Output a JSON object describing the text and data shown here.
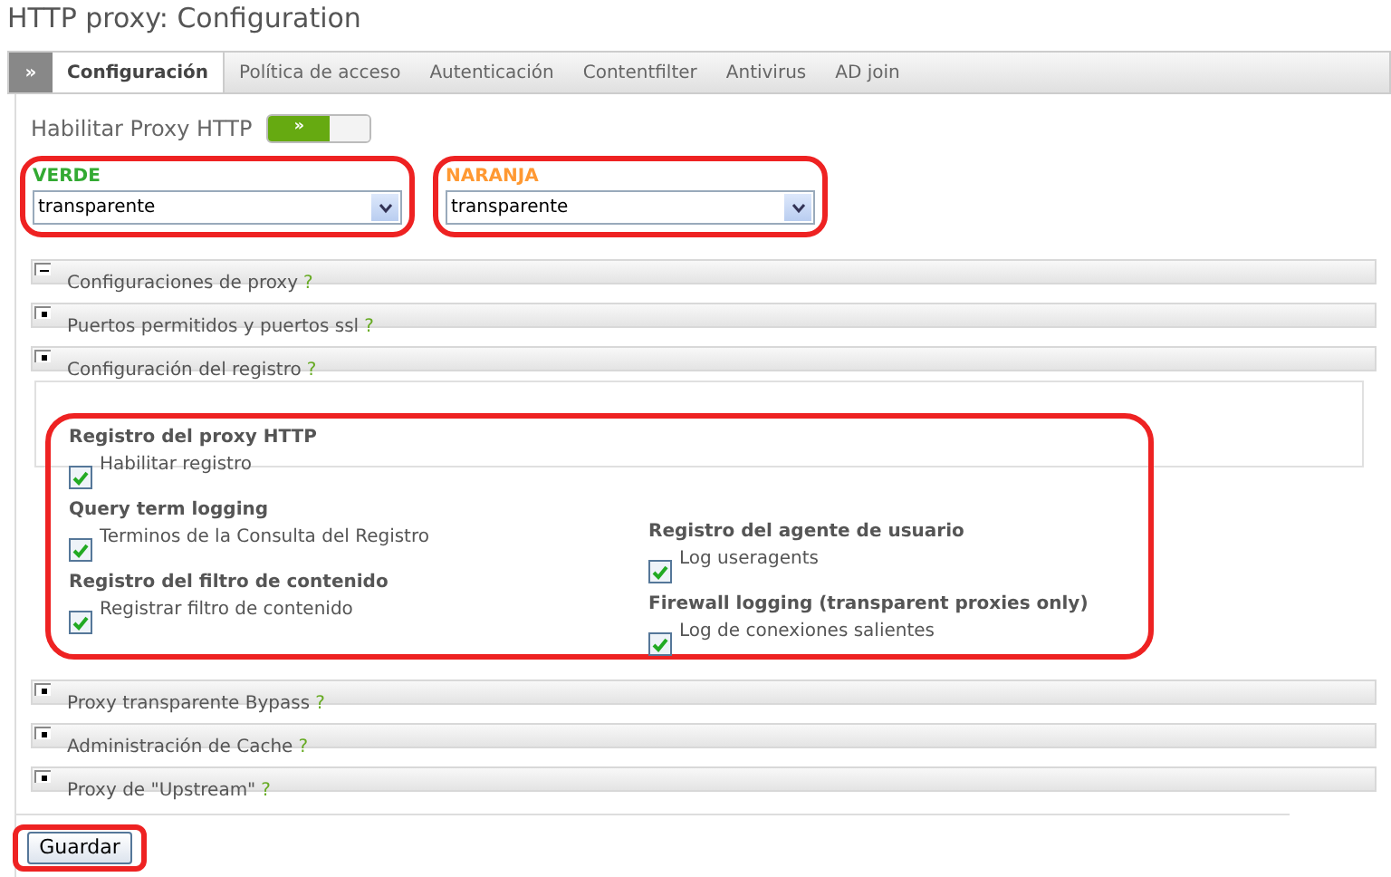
{
  "page_title": "HTTP proxy: Configuration",
  "tabs": [
    {
      "label": "»",
      "kind": "menu",
      "selected": false
    },
    {
      "label": "Configuración",
      "kind": "tab",
      "selected": true
    },
    {
      "label": "Política de acceso",
      "kind": "tab",
      "selected": false
    },
    {
      "label": "Autenticación",
      "kind": "tab",
      "selected": false
    },
    {
      "label": "Contentfilter",
      "kind": "tab",
      "selected": false
    },
    {
      "label": "Antivirus",
      "kind": "tab",
      "selected": false
    },
    {
      "label": "AD join",
      "kind": "tab",
      "selected": false
    }
  ],
  "enable": {
    "label": "Habilitar Proxy HTTP",
    "toggle_text": "»",
    "on": true
  },
  "zones": [
    {
      "label": "VERDE",
      "color": "#33aa33",
      "value": "transparente"
    },
    {
      "label": "NARANJA",
      "color": "#ff9933",
      "value": "transparente"
    }
  ],
  "sections_before": [
    {
      "title": "Configuraciones de proxy",
      "help": "?",
      "expanded": true
    },
    {
      "title": "Puertos permitidos y puertos ssl",
      "help": "?",
      "expanded": false
    },
    {
      "title": "Configuración del registro",
      "help": "?",
      "expanded": false
    }
  ],
  "logging": {
    "left": [
      {
        "heading": "Registro del proxy HTTP",
        "label": "Habilitar registro",
        "checked": true
      },
      {
        "heading": "Query term logging",
        "label": "Terminos de la Consulta del Registro",
        "checked": true
      },
      {
        "heading": "Registro del filtro de contenido",
        "label": "Registrar filtro de contenido",
        "checked": true
      }
    ],
    "right": [
      {
        "heading": "Registro del agente de usuario",
        "label": "Log useragents",
        "checked": true
      },
      {
        "heading": "Firewall logging (transparent proxies only)",
        "label": "Log de conexiones salientes",
        "checked": true
      }
    ]
  },
  "sections_after": [
    {
      "title": "Proxy transparente Bypass",
      "help": "?",
      "expanded": false
    },
    {
      "title": "Administración de Cache",
      "help": "?",
      "expanded": false
    },
    {
      "title": "Proxy de \"Upstream\"",
      "help": "?",
      "expanded": false
    }
  ],
  "save_button": "Guardar"
}
